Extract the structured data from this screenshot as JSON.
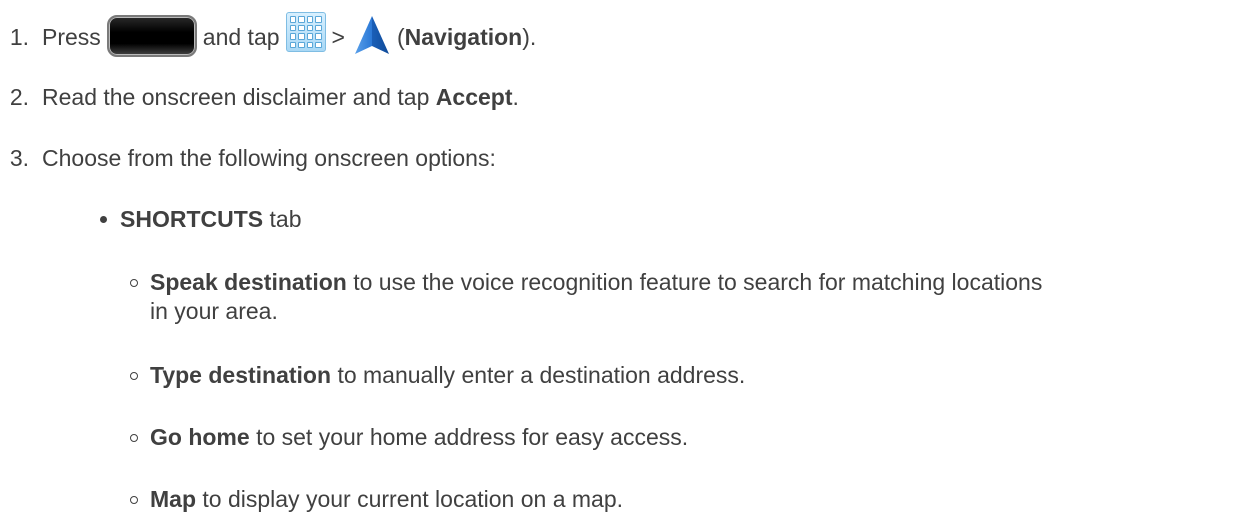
{
  "steps": [
    {
      "num": "1.",
      "press": "Press",
      "and_tap": "and tap",
      "gt": ">",
      "paren_open": "(",
      "bold": "Navigation",
      "paren_close": ")."
    },
    {
      "num": "2.",
      "text": "Read the onscreen disclaimer and tap",
      "bold": "Accept",
      "tail": "."
    },
    {
      "num": "3.",
      "text": "Choose from the following onscreen options:"
    }
  ],
  "tab": {
    "bold": "SHORTCUTS",
    "text": "tab"
  },
  "options": [
    {
      "bold": "Speak destination",
      "text": "to use the voice recognition feature to search for matching locations",
      "text2": "in your area."
    },
    {
      "bold": "Type destination",
      "text": "to manually enter a destination address."
    },
    {
      "bold": "Go home",
      "text": "to set your home address for easy access."
    },
    {
      "bold": "Map",
      "text": "to display your current location on a map."
    }
  ],
  "icons": {
    "home_key": "home-key-icon",
    "apps": "apps-grid-icon",
    "navigation": "navigation-arrow-icon"
  },
  "colors": {
    "text": "#404040",
    "nav_blue": "#1f6fc9"
  }
}
